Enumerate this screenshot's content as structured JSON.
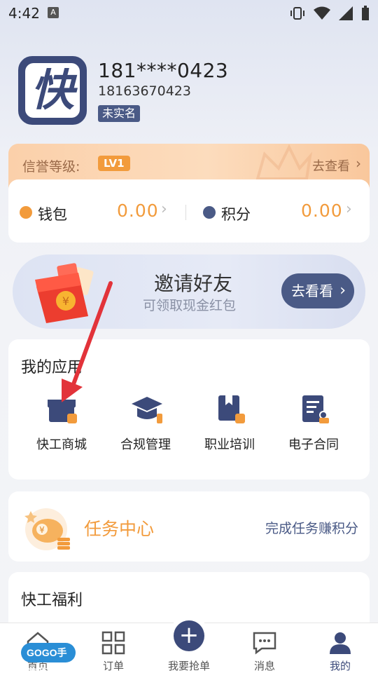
{
  "status_bar": {
    "time": "4:42",
    "indicator": "A"
  },
  "profile": {
    "avatar_char": "快",
    "phone_masked": "181****0423",
    "phone_full": "18163670423",
    "verify_status": "未实名"
  },
  "credit": {
    "label": "信誉等级:",
    "level": "LV1",
    "link": "去查看"
  },
  "wallet": {
    "items": [
      {
        "label": "钱包",
        "value": "0.00"
      },
      {
        "label": "积分",
        "value": "0.00"
      }
    ]
  },
  "invite": {
    "title": "邀请好友",
    "subtitle": "可领取现金红包",
    "button": "去看看"
  },
  "apps": {
    "title": "我的应用",
    "items": [
      {
        "label": "快工商城",
        "icon": "shop-icon"
      },
      {
        "label": "合规管理",
        "icon": "graduation-cap-icon"
      },
      {
        "label": "职业培训",
        "icon": "book-icon"
      },
      {
        "label": "电子合同",
        "icon": "contract-icon"
      }
    ]
  },
  "task": {
    "title": "任务中心",
    "subtitle": "完成任务赚积分"
  },
  "welfare": {
    "title": "快工福利"
  },
  "nav": {
    "items": [
      {
        "label": "首页",
        "icon": "home-icon"
      },
      {
        "label": "订单",
        "icon": "grid-icon"
      },
      {
        "label": "我要抢单",
        "icon": "plus-icon"
      },
      {
        "label": "消息",
        "icon": "message-icon"
      },
      {
        "label": "我的",
        "icon": "user-icon"
      }
    ],
    "active_index": 4
  },
  "watermark": "GOGO手游网",
  "colors": {
    "primary": "#3c4a7a",
    "accent": "#f29b3c",
    "annotation": "#e2333a"
  }
}
